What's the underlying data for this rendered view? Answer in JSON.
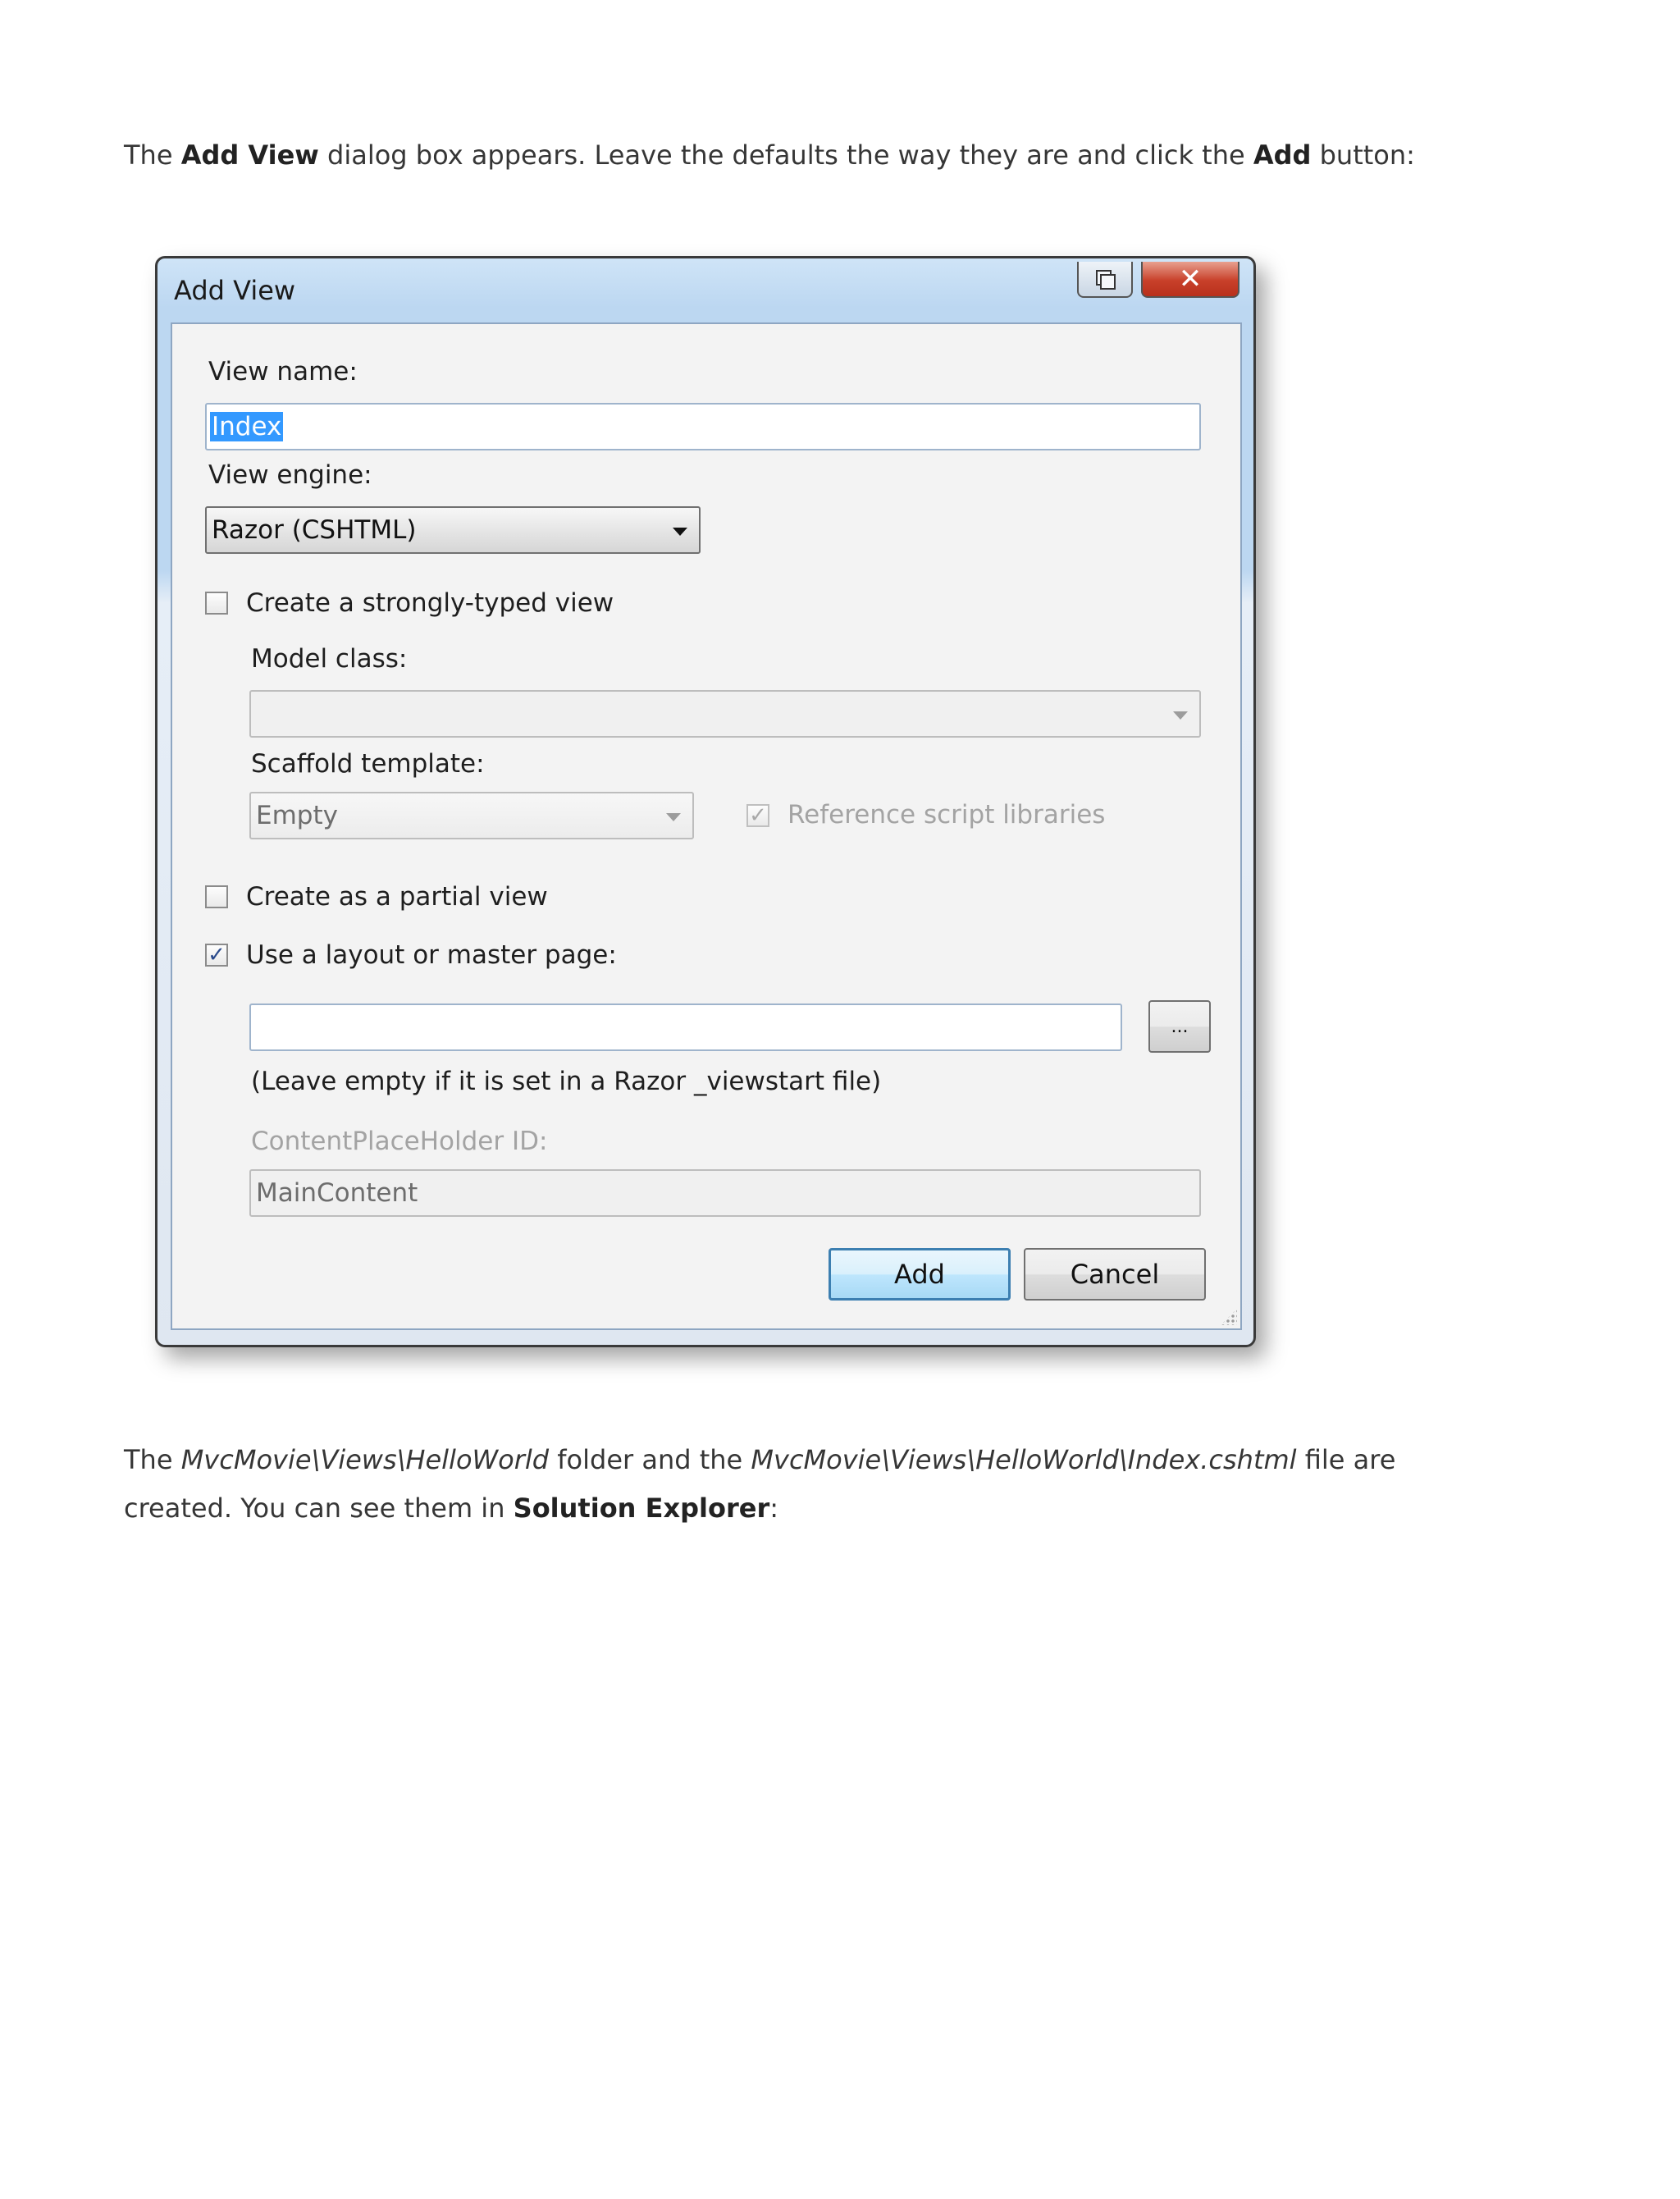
{
  "intro": {
    "t1": "The ",
    "b1": "Add View",
    "t2": " dialog box appears. Leave the defaults the way they are and click the ",
    "b2": "Add",
    "t3": " button:"
  },
  "dialog": {
    "title": "Add View",
    "close_glyph": "✕",
    "view_name_label": "View name:",
    "view_name_value": "Index",
    "view_engine_label": "View engine:",
    "view_engine_value": "Razor (CSHTML)",
    "strongly_typed_label": "Create a strongly-typed view",
    "strongly_typed_checked": false,
    "model_class_label": "Model class:",
    "model_class_value": "",
    "scaffold_label": "Scaffold template:",
    "scaffold_value": "Empty",
    "ref_scripts_label": "Reference script libraries",
    "ref_scripts_checked": true,
    "partial_label": "Create as a partial view",
    "partial_checked": false,
    "layout_label": "Use a layout or master page:",
    "layout_checked": true,
    "layout_value": "",
    "browse_label": "...",
    "layout_hint": "(Leave empty if it is set in a Razor _viewstart file)",
    "placeholder_label": "ContentPlaceHolder ID:",
    "placeholder_value": "MainContent",
    "add_label": "Add",
    "cancel_label": "Cancel",
    "check_glyph": "✓"
  },
  "outro": {
    "t1": "The ",
    "i1": "MvcMovie\\Views\\HelloWorld",
    "t2": " folder and the ",
    "i2": "MvcMovie\\Views\\HelloWorld\\Index.cshtml",
    "t3": " file are created. You can see them in ",
    "b1": "Solution Explorer",
    "t4": ":"
  }
}
